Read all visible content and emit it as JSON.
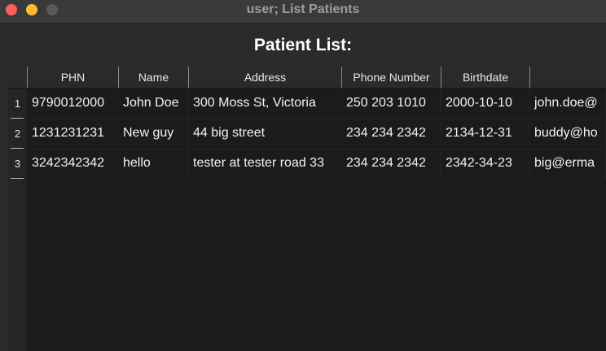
{
  "window": {
    "title": "user; List Patients"
  },
  "page": {
    "title": "Patient List:"
  },
  "table": {
    "columns": [
      "PHN",
      "Name",
      "Address",
      "Phone Number",
      "Birthdate",
      ""
    ],
    "row_numbers": [
      "1",
      "2",
      "3"
    ],
    "rows": [
      [
        "9790012000",
        "John Doe",
        "300 Moss St, Victoria",
        "250 203 1010",
        "2000-10-10",
        "john.doe@"
      ],
      [
        "1231231231",
        "New guy",
        "44 big street",
        "234 234 2342",
        "2134-12-31",
        "buddy@ho"
      ],
      [
        "3242342342",
        "hello",
        "tester at tester road 33",
        "234 234 2342",
        "2342-34-23",
        "big@erma"
      ]
    ]
  },
  "colors": {
    "close": "#ff5f57",
    "minimize": "#febc2e",
    "zoom": "#5a5a5a",
    "table_bg": "#1b1b1b"
  }
}
